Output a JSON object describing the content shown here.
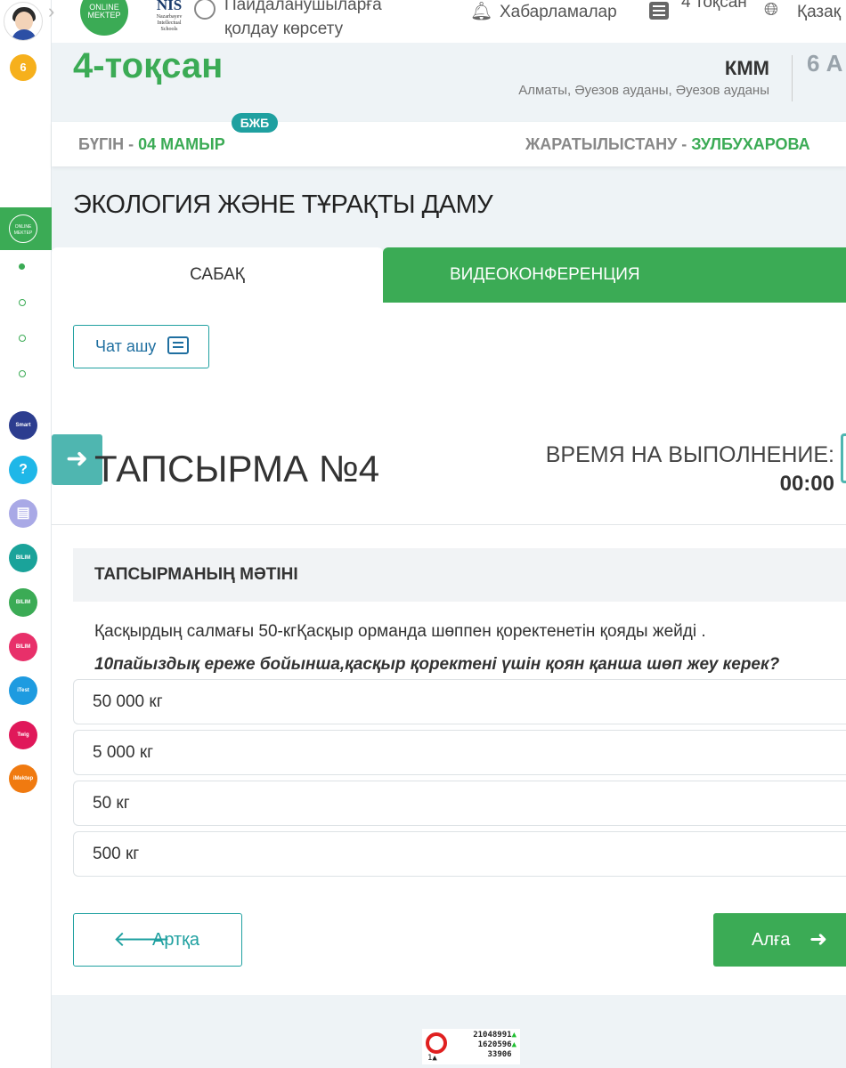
{
  "header": {
    "logo_text": "ONLINE MEKTEP",
    "nis_logo": {
      "big": "NIS",
      "small": "Nazarbayev Intellectual Schools"
    },
    "support_label": "Пайдаланушыларға қолдау көрсету",
    "notifications_label": "Хабарламалар",
    "quarter_label": "4 тоқсан",
    "language_label": "Қазақ"
  },
  "rail": {
    "badge_count": "6",
    "logo_text": "ONLINE MEKTEP",
    "apps": [
      {
        "name": "smart-nation",
        "label": "Smart Nation",
        "color": "#2c3d8f"
      },
      {
        "name": "help",
        "label": "?",
        "color": "#1fb7e8"
      },
      {
        "name": "news",
        "label": "▤",
        "color": "#a9a9e6"
      },
      {
        "name": "bilim-center",
        "label": "BILIM CENTER",
        "color": "#1aa39a"
      },
      {
        "name": "bilim-land",
        "label": "BILIM Land",
        "color": "#3bab55"
      },
      {
        "name": "bilim-shop",
        "label": "BILIM SHOP",
        "color": "#e8306a"
      },
      {
        "name": "itest",
        "label": "iTest",
        "color": "#1e9be0"
      },
      {
        "name": "twig",
        "label": "Twig",
        "color": "#e0185a"
      },
      {
        "name": "imektep",
        "label": "iMektep",
        "color": "#f07a10"
      }
    ]
  },
  "hero": {
    "quarter": "4-тоқсан",
    "school": "КММ",
    "address": "Алматы, Әуезов ауданы, Әуезов ауданы",
    "class_label": "6 А"
  },
  "datebar": {
    "today_label": "БҮГІН - ",
    "today_date": "04 МАМЫР",
    "badge": "БЖБ",
    "subject": "ЖАРАТЫЛЫСТАНУ - ",
    "teacher": "ЗУЛБУХАРОВА"
  },
  "lesson": {
    "title": "ЭКОЛОГИЯ ЖӘНЕ ТҰРАҚТЫ ДАМУ",
    "tab_lesson": "САБАҚ",
    "tab_video": "ВИДЕОКОНФЕРЕНЦИЯ",
    "chat_button": "Чат ашу"
  },
  "task": {
    "title": "ТАПСЫРМА №4",
    "time_label": "ВРЕМЯ НА ВЫПОЛНЕНИЕ:",
    "time_value": "00:00",
    "text_header": "ТАПСЫРМАНЫҢ МӘТІНІ",
    "question_text": "Қасқырдың салмағы 50-кгҚасқыр орманда шөппен қоректенетін қояды жейді .",
    "question_bold": "10пайыздық ереже бойынша,қасқыр қоректені үшін қоян қанша шөп жеу керек?",
    "options": [
      "50 000 кг",
      "5 000 кг",
      "50 кг",
      "500 кг"
    ],
    "back_button": "Артқа",
    "next_button": "Алға"
  },
  "counter": {
    "one": "1",
    "line1": "21048991",
    "line2": "1620596",
    "line3": "33906"
  }
}
